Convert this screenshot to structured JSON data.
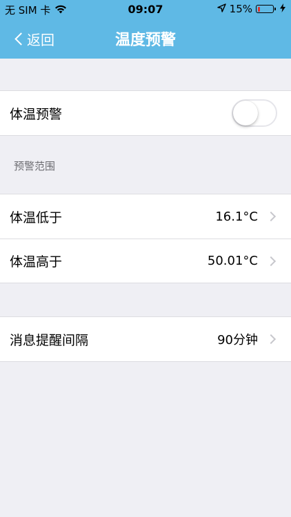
{
  "statusbar": {
    "carrier": "无 SIM 卡",
    "time": "09:07",
    "battery_percent": "15%",
    "battery_level": 0.15,
    "icons": [
      "wifi-icon",
      "location-arrow-icon",
      "battery-icon",
      "charging-bolt-icon"
    ]
  },
  "colors": {
    "header": "#5fb9e5",
    "background": "#efeff4",
    "battery_low": "#e0322f"
  },
  "navbar": {
    "back_label": "返回",
    "title": "温度预警"
  },
  "alert_toggle": {
    "label": "体温预警",
    "enabled": false
  },
  "range_section": {
    "header": "预警范围",
    "rows": [
      {
        "label": "体温低于",
        "value": "16.1°C"
      },
      {
        "label": "体温高于",
        "value": "50.01°C"
      }
    ]
  },
  "interval": {
    "label": "消息提醒间隔",
    "value": "90分钟"
  }
}
